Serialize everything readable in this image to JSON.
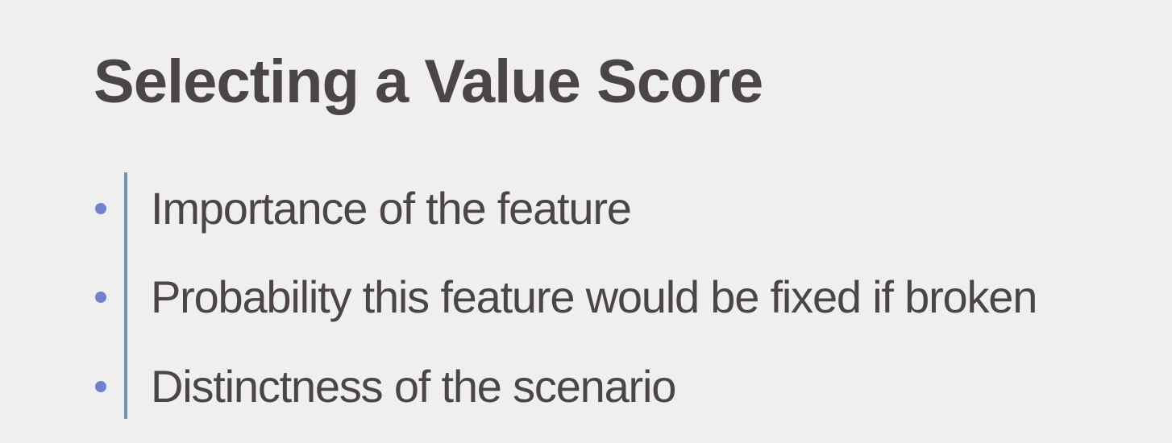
{
  "slide": {
    "title": "Selecting a Value Score",
    "bullets": [
      {
        "text": "Importance of the feature"
      },
      {
        "text": "Probability this feature would be fixed if broken"
      },
      {
        "text": "Distinctness of the scenario"
      }
    ]
  },
  "colors": {
    "background": "#efefef",
    "text": "#4b4449",
    "bullet": "#7081ce",
    "rule": "#6d99ad"
  }
}
